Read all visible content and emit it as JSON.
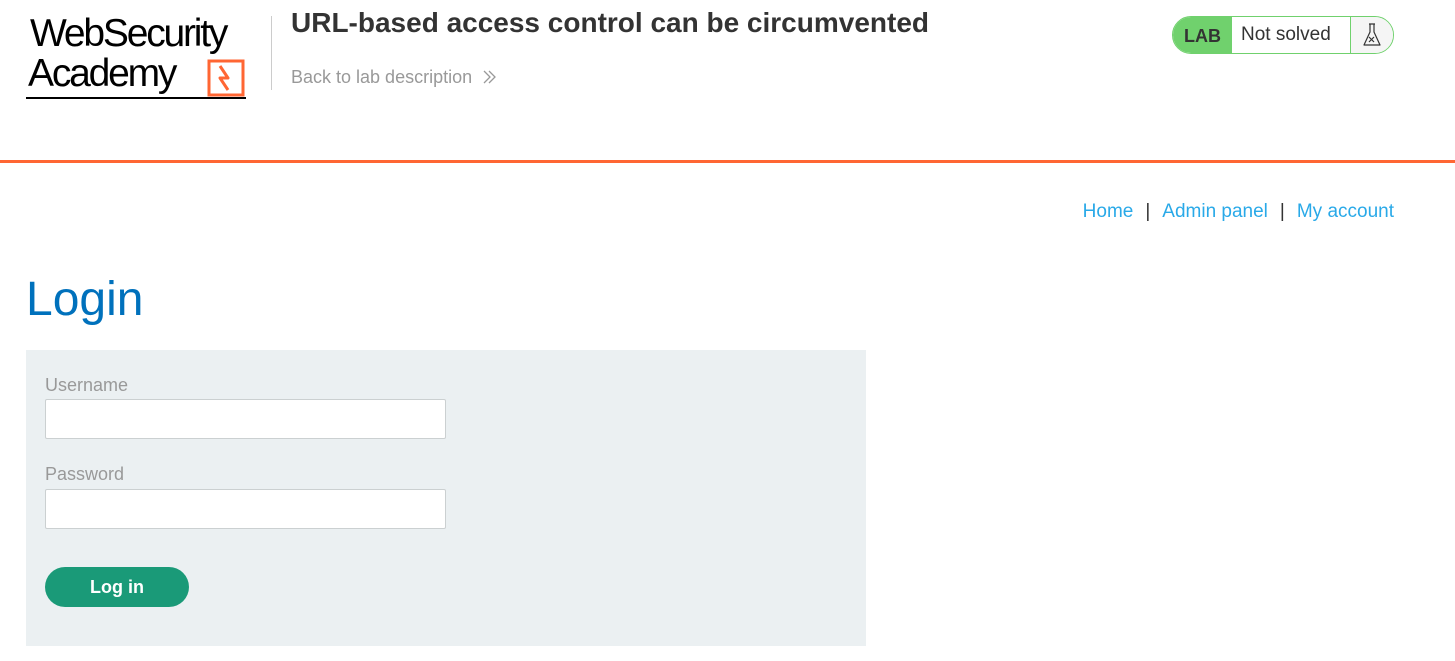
{
  "header": {
    "logo": {
      "line1": "WebSecurity",
      "line2": "Academy"
    },
    "lab_title": "URL-based access control can be circumvented",
    "back_link": "Back to lab description",
    "status": {
      "badge": "LAB",
      "text": "Not solved",
      "icon": "flask-icon",
      "color": "#70d16d"
    },
    "accent_color": "#ff6633"
  },
  "nav": {
    "items": [
      {
        "label": "Home"
      },
      {
        "label": "Admin panel"
      },
      {
        "label": "My account"
      }
    ],
    "separator": "|"
  },
  "main": {
    "title": "Login",
    "form": {
      "username_label": "Username",
      "username_value": "",
      "password_label": "Password",
      "password_value": "",
      "submit_label": "Log in"
    }
  }
}
